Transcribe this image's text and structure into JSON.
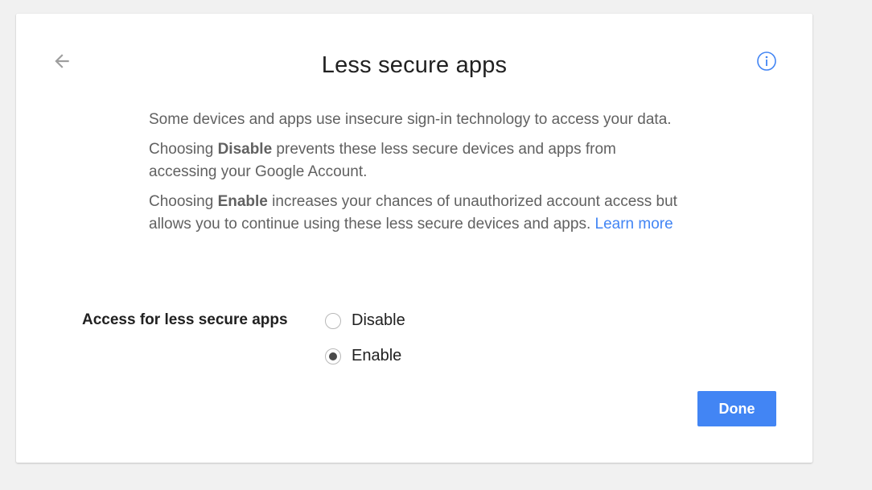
{
  "dialog": {
    "title": "Less secure apps",
    "back_icon": "arrow-left-icon",
    "info_icon": "info-icon"
  },
  "description": {
    "p1": "Some devices and apps use insecure sign-in technology to access your data.",
    "p2_prefix": "Choosing ",
    "p2_bold": "Disable",
    "p2_suffix": " prevents these less secure devices and apps from accessing your Google Account.",
    "p3_prefix": "Choosing ",
    "p3_bold": "Enable",
    "p3_suffix": " increases your chances of unauthorized account access but allows you to continue using these less secure devices and apps. ",
    "learn_more": "Learn more"
  },
  "setting": {
    "label": "Access for less secure apps",
    "options": [
      {
        "label": "Disable",
        "selected": false
      },
      {
        "label": "Enable",
        "selected": true
      }
    ]
  },
  "actions": {
    "done_label": "Done"
  },
  "colors": {
    "accent": "#4285f4",
    "background": "#f1f1f1",
    "card": "#ffffff"
  }
}
